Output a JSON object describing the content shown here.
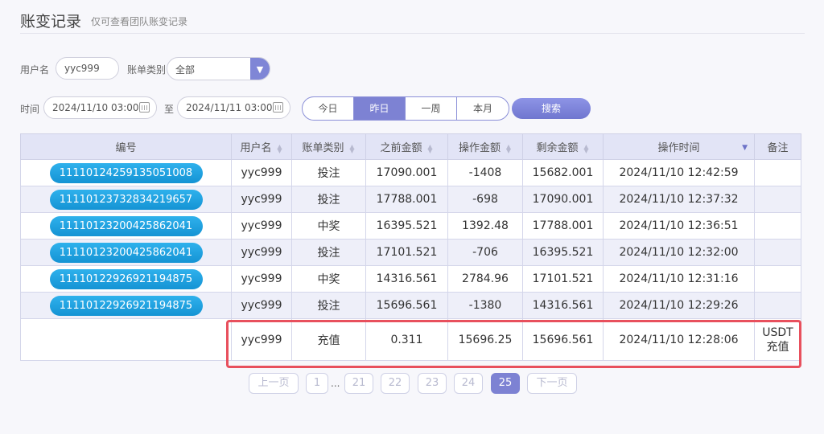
{
  "header": {
    "title": "账变记录",
    "subtitle": "仅可查看团队账变记录"
  },
  "filters": {
    "username_label": "用户名",
    "username_value": "yyc999",
    "category_label": "账单类别",
    "category_value": "全部",
    "time_label": "时间",
    "start_time": "2024/11/10 03:00",
    "to_label": "至",
    "end_time": "2024/11/11 03:00",
    "quick_ranges": [
      "今日",
      "昨日",
      "一周",
      "本月"
    ],
    "active_range": "昨日",
    "search_label": "搜索"
  },
  "table": {
    "headers": [
      "编号",
      "用户名",
      "账单类别",
      "之前金额",
      "操作金额",
      "剩余金额",
      "操作时间",
      "备注"
    ],
    "rows": [
      {
        "id": "11110124259135051008",
        "user": "yyc999",
        "type": "投注",
        "before": "17090.001",
        "amount": "-1408",
        "after": "15682.001",
        "time": "2024/11/10 12:42:59",
        "note": ""
      },
      {
        "id": "11110123732834219657",
        "user": "yyc999",
        "type": "投注",
        "before": "17788.001",
        "amount": "-698",
        "after": "17090.001",
        "time": "2024/11/10 12:37:32",
        "note": ""
      },
      {
        "id": "11110123200425862041",
        "user": "yyc999",
        "type": "中奖",
        "before": "16395.521",
        "amount": "1392.48",
        "after": "17788.001",
        "time": "2024/11/10 12:36:51",
        "note": ""
      },
      {
        "id": "11110123200425862041",
        "user": "yyc999",
        "type": "投注",
        "before": "17101.521",
        "amount": "-706",
        "after": "16395.521",
        "time": "2024/11/10 12:32:00",
        "note": ""
      },
      {
        "id": "11110122926921194875",
        "user": "yyc999",
        "type": "中奖",
        "before": "14316.561",
        "amount": "2784.96",
        "after": "17101.521",
        "time": "2024/11/10 12:31:16",
        "note": ""
      },
      {
        "id": "11110122926921194875",
        "user": "yyc999",
        "type": "投注",
        "before": "15696.561",
        "amount": "-1380",
        "after": "14316.561",
        "time": "2024/11/10 12:29:26",
        "note": ""
      },
      {
        "id": "",
        "user": "yyc999",
        "type": "充值",
        "before": "0.311",
        "amount": "15696.25",
        "after": "15696.561",
        "time": "2024/11/10 12:28:06",
        "note_line1": "USDT",
        "note_line2": "充值"
      }
    ]
  },
  "pagination": {
    "prev": "上一页",
    "first": "1",
    "ellipsis": "...",
    "pages": [
      "21",
      "22",
      "23",
      "24",
      "25"
    ],
    "current": "25",
    "next": "下一页"
  },
  "colors": {
    "accent": "#7d82d3",
    "id_pill": "#1ea3e0",
    "highlight": "#e8505d"
  }
}
